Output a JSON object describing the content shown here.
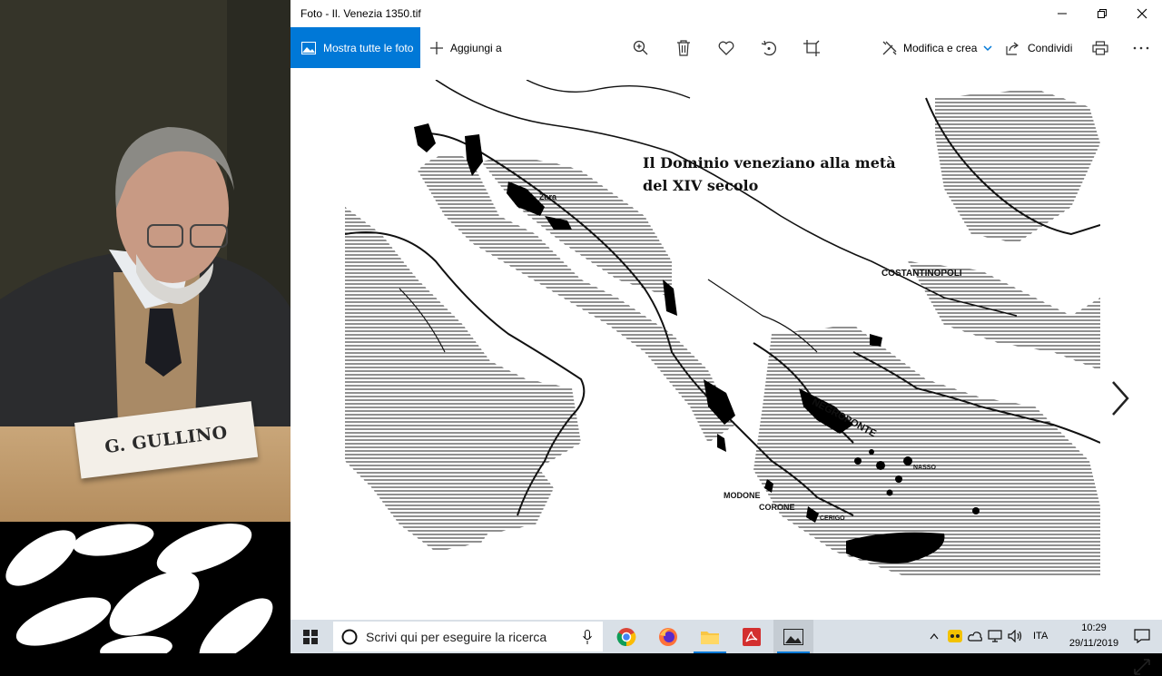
{
  "camera": {
    "name_plate": "G. GULLINO"
  },
  "window": {
    "title": "Foto - Il. Venezia 1350.tif",
    "controls": {
      "minimize": "minimize-icon",
      "maximize": "maximize-icon",
      "close": "close-icon"
    }
  },
  "toolbar": {
    "show_all_label": "Mostra tutte le foto",
    "add_to_label": "Aggiungi a",
    "edit_create_label": "Modifica e crea",
    "share_label": "Condividi",
    "icons": [
      "zoom-icon",
      "delete-icon",
      "favorite-icon",
      "rotate-icon",
      "crop-icon",
      "print-icon",
      "more-icon"
    ]
  },
  "map": {
    "title_line1": "Il Dominio veneziano alla metà",
    "title_line2": "del XIV secolo",
    "labels": {
      "zara": "Zara",
      "costantinopoli": "COSTANTINOPOLI",
      "negroponte": "NEGROPONTE",
      "nasso": "NASSO",
      "modone": "MODONE",
      "corone": "CORONE",
      "cerigo": "CERIGO"
    }
  },
  "taskbar": {
    "search_placeholder": "Scrivi qui per eseguire la ricerca",
    "language": "ITA",
    "time": "10:29",
    "date": "29/11/2019"
  },
  "colors": {
    "accent": "#0078d7",
    "taskbar": "#d9e0e7"
  }
}
